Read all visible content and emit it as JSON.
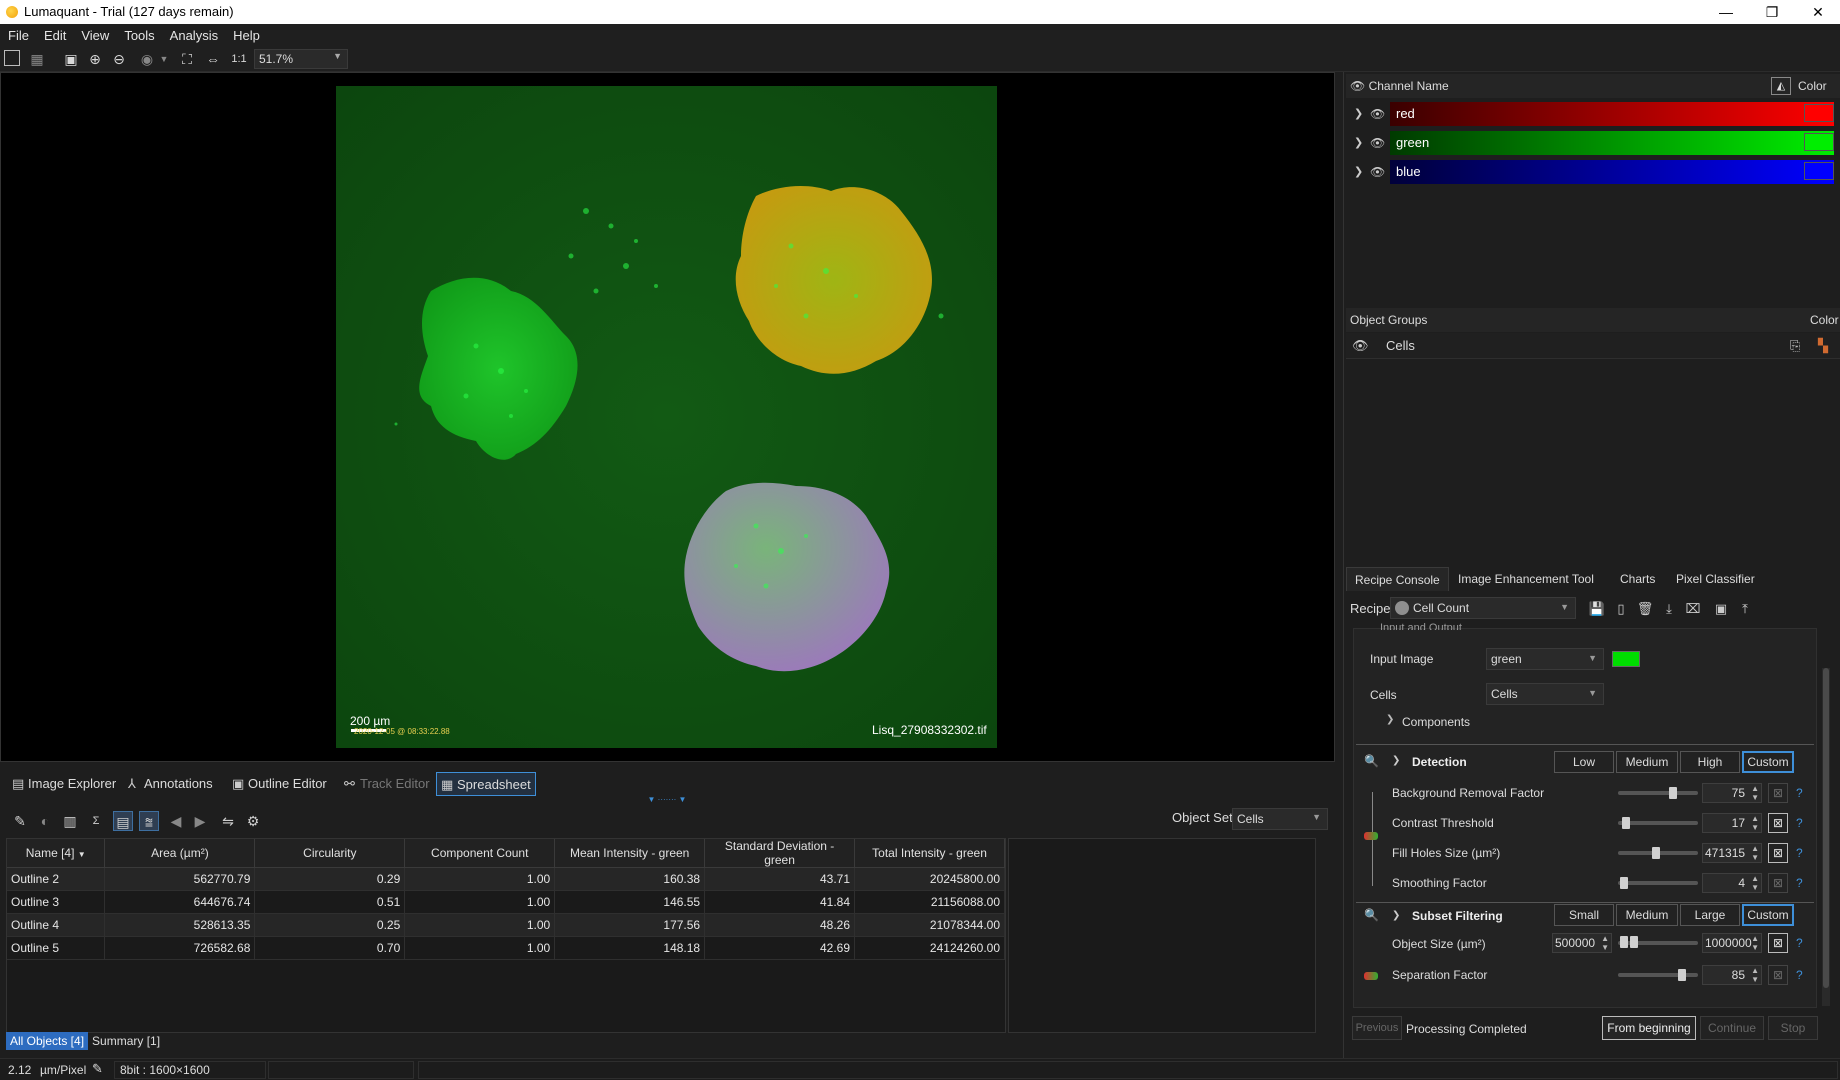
{
  "window": {
    "title": "Lumaquant - Trial (127 days remain)",
    "minimize": "—",
    "maximize": "❐",
    "close": "✕"
  },
  "menu": [
    "File",
    "Edit",
    "View",
    "Tools",
    "Analysis",
    "Help"
  ],
  "toolbar": {
    "zoom_value": "51.7%",
    "actual_size_label": "1:1"
  },
  "image": {
    "filename": "Lisq_27908332302.tif",
    "scale_label": "200 µm",
    "timestamp": "2020-12-05 @ 08:33:22.88"
  },
  "bottom_tabs": [
    "Image Explorer",
    "Annotations",
    "Outline Editor",
    "Track Editor",
    "Spreadsheet"
  ],
  "object_set": {
    "label": "Object Set",
    "value": "Cells"
  },
  "sheet": {
    "columns": [
      "Name [4]",
      "Area (µm²)",
      "Circularity",
      "Component Count",
      "Mean Intensity - green",
      "Standard Deviation - green",
      "Total Intensity - green"
    ],
    "rows": [
      [
        "Outline 2",
        "562770.79",
        "0.29",
        "1.00",
        "160.38",
        "43.71",
        "20245800.00"
      ],
      [
        "Outline 3",
        "644676.74",
        "0.51",
        "1.00",
        "146.55",
        "41.84",
        "21156088.00"
      ],
      [
        "Outline 4",
        "528613.35",
        "0.25",
        "1.00",
        "177.56",
        "48.26",
        "21078344.00"
      ],
      [
        "Outline 5",
        "726582.68",
        "0.70",
        "1.00",
        "148.18",
        "42.69",
        "24124260.00"
      ]
    ],
    "sub_tabs": [
      "All Objects [4]",
      "Summary [1]"
    ]
  },
  "status": {
    "pixel_size": "2.12",
    "pixel_unit": "µm/Pixel",
    "image_info": "8bit : 1600×1600"
  },
  "channels": {
    "header_name": "Channel Name",
    "header_color": "Color",
    "items": [
      {
        "name": "red",
        "color": "#ff0000"
      },
      {
        "name": "green",
        "color": "#00ee00"
      },
      {
        "name": "blue",
        "color": "#0000ff"
      }
    ]
  },
  "object_groups": {
    "header": "Object Groups",
    "header_color": "Color",
    "items": [
      "Cells"
    ]
  },
  "right_tabs": [
    "Recipe Console",
    "Image Enhancement Tool",
    "Charts",
    "Pixel Classifier"
  ],
  "recipe": {
    "label": "Recipe",
    "value": "Cell Count",
    "io_header": "Input and Output",
    "input_image_label": "Input Image",
    "input_image_value": "green",
    "input_image_color": "#00dd00",
    "cells_label": "Cells",
    "cells_value": "Cells",
    "components_label": "Components",
    "detection": {
      "title": "Detection",
      "presets": [
        "Low",
        "Medium",
        "High",
        "Custom"
      ],
      "params": [
        {
          "label": "Background Removal Factor",
          "value": "75"
        },
        {
          "label": "Contrast Threshold",
          "value": "17"
        },
        {
          "label": "Fill Holes Size (µm²)",
          "value": "471315"
        },
        {
          "label": "Smoothing Factor",
          "value": "4"
        }
      ]
    },
    "subset": {
      "title": "Subset Filtering",
      "presets": [
        "Small",
        "Medium",
        "Large",
        "Custom"
      ],
      "object_size_label": "Object Size (µm²)",
      "object_size_min": "500000",
      "object_size_max": "1000000",
      "separation_label": "Separation Factor",
      "separation_value": "85"
    },
    "controls": {
      "previous": "Previous",
      "status": "Processing Completed",
      "from_beginning": "From beginning",
      "continue": "Continue",
      "stop": "Stop"
    }
  }
}
